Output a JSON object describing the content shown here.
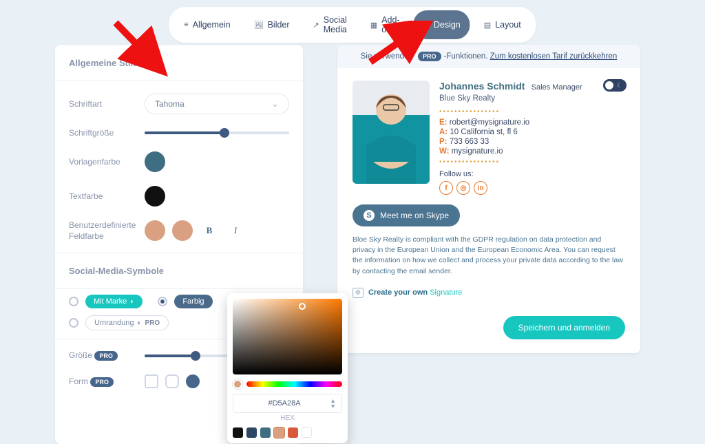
{
  "nav": {
    "tabs": [
      {
        "label": "Allgemein",
        "icon": "≡"
      },
      {
        "label": "Bilder",
        "icon": "🖼"
      },
      {
        "label": "Social Media",
        "icon": "↗"
      },
      {
        "label": "Add-ons",
        "icon": "▦"
      },
      {
        "label": "Design",
        "icon": "✎",
        "active": true
      },
      {
        "label": "Layout",
        "icon": "▤"
      }
    ]
  },
  "left": {
    "section": "Allgemeine Stile",
    "font_label": "Schriftart",
    "font_value": "Tahoma",
    "size_label": "Schriftgröße",
    "size_percent": 55,
    "template_label": "Vorlagenfarbe",
    "template_color": "#3f6e82",
    "text_label": "Textfarbe",
    "text_color": "#111111",
    "custom_label": "Benutzerdefinierte Feldfarbe",
    "custom_color": "#d9a182",
    "social_section": "Social-Media-Symbole",
    "opt_brand": "Mit Marke",
    "opt_color": "Farbig",
    "opt_outline": "Umrandung",
    "pro_badge": "PRO",
    "size2_label": "Größe",
    "size2_percent": 35,
    "form_label": "Form"
  },
  "picker": {
    "hex": "#D5A28A",
    "hex_label": "HEX",
    "swatches": [
      "#111111",
      "#2b4865",
      "#3f6e82",
      "#d9a182",
      "#d9593a",
      "#ffffff"
    ]
  },
  "right": {
    "notice_pre": "Sie verwenden",
    "notice_badge": "PRO",
    "notice_mid": "-Funktionen.",
    "notice_link": "Zum kostenlosen Tarif zurückkehren",
    "name": "Johannes Schmidt",
    "title": "Sales Manager",
    "company": "Blue Sky Realty",
    "email_k": "E:",
    "email_v": "robert@mysignature.io",
    "addr_k": "A:",
    "addr_v": "10 California st, fl 6",
    "phone_k": "P:",
    "phone_v": "733 663 33",
    "web_k": "W:",
    "web_v": "mysignature.io",
    "follow": "Follow us:",
    "skype": "Meet me on Skype",
    "disclaimer": "Bloe Sky Realty is compliant with the GDPR regulation on data protection and privacy in the European Union and the European Economic Area. You can request the information on how we collect and process your private data according to the law by contacting the email sender.",
    "create_pre": "Create your own",
    "create_sig": "Signature",
    "save": "Speichern und anmelden"
  }
}
